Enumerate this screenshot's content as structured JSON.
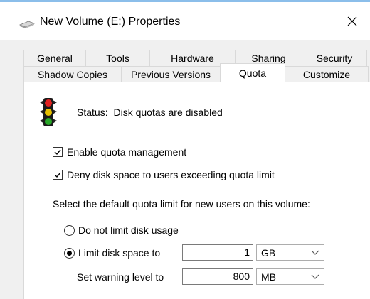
{
  "window": {
    "title": "New Volume (E:) Properties",
    "close_symbol": "✕"
  },
  "tabs": {
    "row1": [
      "General",
      "Tools",
      "Hardware",
      "Sharing",
      "Security"
    ],
    "row2": [
      "Shadow Copies",
      "Previous Versions",
      "Quota",
      "Customize"
    ],
    "active": "Quota"
  },
  "quota": {
    "status_label": "Status:",
    "status_value": "Disk quotas are disabled",
    "enable_label": "Enable quota management",
    "enable_checked": true,
    "deny_label": "Deny disk space to users exceeding quota limit",
    "deny_checked": true,
    "prompt": "Select the default quota limit for new users on this volume:",
    "no_limit_label": "Do not limit disk usage",
    "limit_label": "Limit disk space to",
    "limit_value": "1",
    "limit_unit": "GB",
    "warning_label": "Set warning level to",
    "warning_value": "800",
    "warning_unit": "MB",
    "selected_option": "limit"
  },
  "icons": {
    "title": "drive-icon",
    "status": "traffic-light-icon",
    "close": "close-icon"
  },
  "colors": {
    "accent": "#2b88d8",
    "tab_border": "#d9d9d9",
    "panel_bg": "#ffffff",
    "frame_bg": "#f0f0f0"
  }
}
